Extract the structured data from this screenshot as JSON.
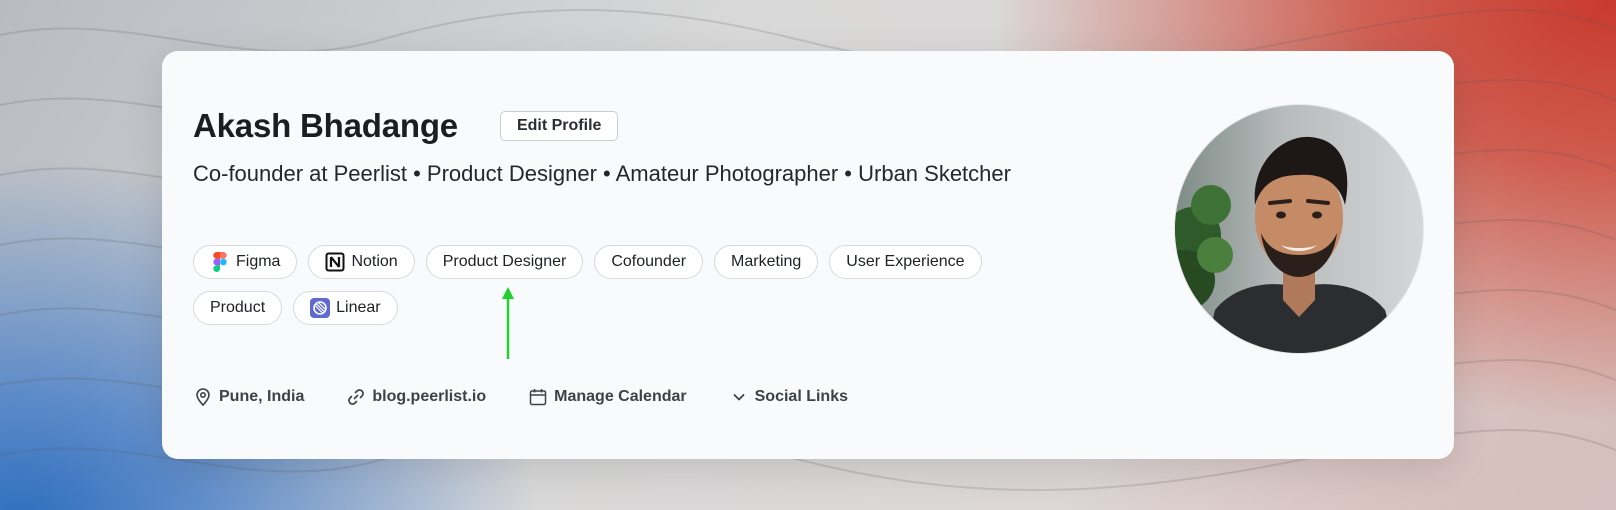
{
  "profile": {
    "name": "Akash Bhadange",
    "edit_label": "Edit Profile",
    "tagline": "Co-founder at Peerlist • Product Designer • Amateur Photographer • Urban Sketcher"
  },
  "tags": [
    {
      "label": "Figma",
      "icon": "figma-icon"
    },
    {
      "label": "Notion",
      "icon": "notion-icon"
    },
    {
      "label": "Product Designer"
    },
    {
      "label": "Cofounder"
    },
    {
      "label": "Marketing"
    },
    {
      "label": "User Experience"
    },
    {
      "label": "Product"
    },
    {
      "label": "Linear",
      "icon": "linear-icon"
    }
  ],
  "meta": {
    "location": "Pune, India",
    "website": "blog.peerlist.io",
    "calendar": "Manage Calendar",
    "social": "Social Links"
  },
  "colors": {
    "accent_arrow": "#1fd12a",
    "card_bg": "#f8fafb",
    "bg_left": "#2f6fbe",
    "bg_right": "#c8392e"
  }
}
